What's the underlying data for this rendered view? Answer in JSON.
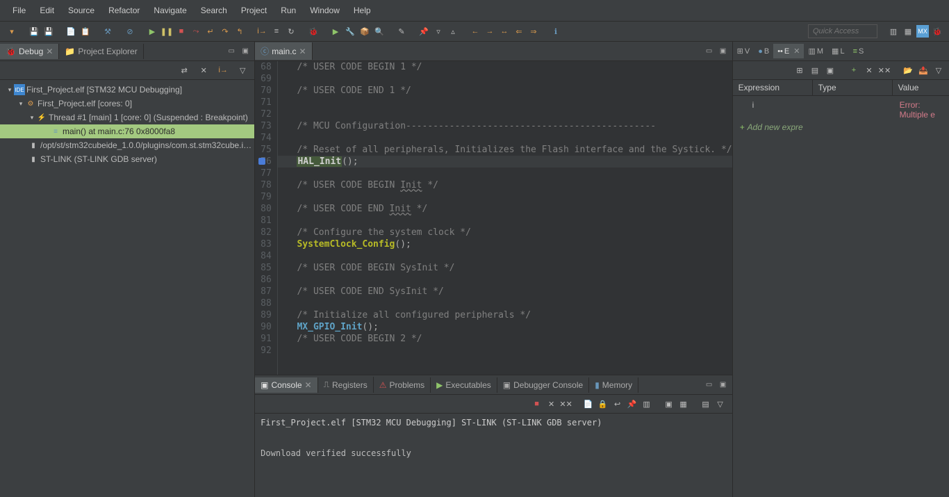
{
  "menu": [
    "File",
    "Edit",
    "Source",
    "Refactor",
    "Navigate",
    "Search",
    "Project",
    "Run",
    "Window",
    "Help"
  ],
  "quickAccess": "Quick Access",
  "leftTabs": {
    "debug": "Debug",
    "projectExplorer": "Project Explorer"
  },
  "tree": {
    "root": "First_Project.elf [STM32 MCU Debugging]",
    "proj": "First_Project.elf [cores: 0]",
    "thread": "Thread #1 [main] 1 [core: 0] (Suspended : Breakpoint)",
    "frame": "main() at main.c:76 0x8000fa8",
    "plugin": "/opt/st/stm32cubeide_1.0.0/plugins/com.st.stm32cube.i…",
    "stlink": "ST-LINK (ST-LINK GDB server)"
  },
  "editor": {
    "tab": "main.c",
    "startLine": 68,
    "lines": [
      {
        "t": "  /* USER CODE BEGIN 1 */",
        "c": "c-comment"
      },
      {
        "t": "",
        "c": ""
      },
      {
        "t": "  /* USER CODE END 1 */",
        "c": "c-comment"
      },
      {
        "t": "",
        "c": ""
      },
      {
        "t": "",
        "c": ""
      },
      {
        "t": "  /* MCU Configuration----------------------------------------------",
        "c": "c-comment"
      },
      {
        "t": "",
        "c": ""
      },
      {
        "t": "  /* Reset of all peripherals, Initializes the Flash interface and the Systick. */",
        "c": "c-comment"
      },
      {
        "t": "HAL_Init",
        "fn": true,
        "tail": "();",
        "current": true,
        "bp": true
      },
      {
        "t": "",
        "c": ""
      },
      {
        "t": "  /* USER CODE BEGIN Init */",
        "c": "c-comment",
        "ul": "Init"
      },
      {
        "t": "",
        "c": ""
      },
      {
        "t": "  /* USER CODE END Init */",
        "c": "c-comment",
        "ul": "Init"
      },
      {
        "t": "",
        "c": ""
      },
      {
        "t": "  /* Configure the system clock */",
        "c": "c-comment"
      },
      {
        "t": "SystemClock_Config",
        "fn": true,
        "tail": "();"
      },
      {
        "t": "",
        "c": ""
      },
      {
        "t": "  /* USER CODE BEGIN SysInit */",
        "c": "c-comment"
      },
      {
        "t": "",
        "c": ""
      },
      {
        "t": "  /* USER CODE END SysInit */",
        "c": "c-comment"
      },
      {
        "t": "",
        "c": ""
      },
      {
        "t": "  /* Initialize all configured peripherals */",
        "c": "c-comment"
      },
      {
        "t": "MX_GPIO_Init",
        "fn2": true,
        "tail": "();"
      },
      {
        "t": "  /* USER CODE BEGIN 2 */",
        "c": "c-comment"
      },
      {
        "t": "",
        "c": ""
      }
    ]
  },
  "bottomTabs": [
    "Console",
    "Registers",
    "Problems",
    "Executables",
    "Debugger Console",
    "Memory"
  ],
  "console": {
    "title": "First_Project.elf [STM32 MCU Debugging] ST-LINK (ST-LINK GDB server)",
    "body": "Download verified successfully"
  },
  "rightMiniTabs": [
    "V",
    "B",
    "E",
    "M",
    "L",
    "S"
  ],
  "expressions": {
    "cols": {
      "expr": "Expression",
      "type": "Type",
      "value": "Value"
    },
    "rows": [
      {
        "expr": "i",
        "type": "",
        "value": "Error: Multiple e"
      }
    ],
    "add": "Add new expre"
  }
}
